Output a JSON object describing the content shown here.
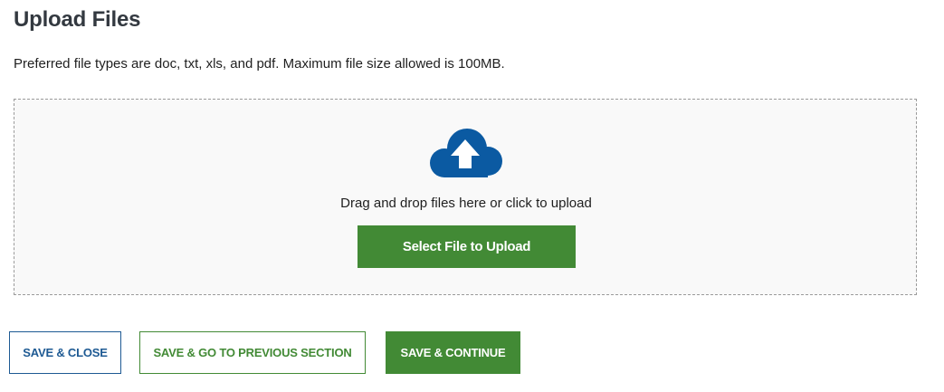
{
  "header": {
    "title": "Upload Files",
    "hint": "Preferred file types are doc, txt, xls, and pdf. Maximum file size allowed is 100MB."
  },
  "dropzone": {
    "icon": "cloud-upload-icon",
    "text": "Drag and drop files here or click to upload",
    "select_label": "Select File to Upload"
  },
  "actions": {
    "save_close": "SAVE & CLOSE",
    "save_previous": "SAVE & GO TO PREVIOUS SECTION",
    "save_continue": "SAVE & CONTINUE"
  },
  "colors": {
    "primary_green": "#428a35",
    "primary_blue": "#1e5a93",
    "icon_blue": "#0b5aa2",
    "title_gray": "#333940"
  }
}
